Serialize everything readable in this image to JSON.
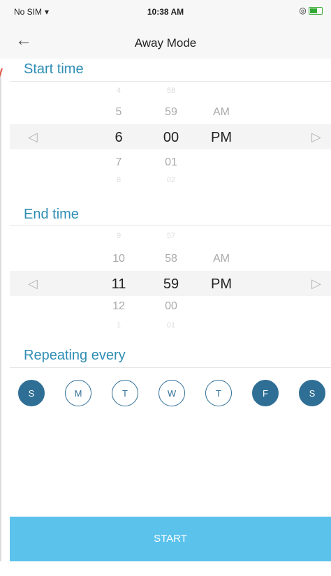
{
  "status": {
    "carrier": "No SIM",
    "time": "10:38 AM"
  },
  "nav": {
    "back_icon": "arrow-left-icon",
    "title": "Away Mode"
  },
  "start": {
    "title": "Start time",
    "hours": [
      "4",
      "5",
      "6",
      "7",
      "8"
    ],
    "minutes": [
      "58",
      "59",
      "00",
      "01",
      "02"
    ],
    "ampm": [
      "AM",
      "PM"
    ]
  },
  "end": {
    "title": "End time",
    "hours": [
      "9",
      "10",
      "11",
      "12",
      "1"
    ],
    "minutes": [
      "57",
      "58",
      "59",
      "00",
      "01"
    ],
    "ampm": [
      "AM",
      "PM"
    ]
  },
  "repeat": {
    "title": "Repeating every",
    "days": [
      {
        "label": "S",
        "selected": true
      },
      {
        "label": "M",
        "selected": false
      },
      {
        "label": "T",
        "selected": false
      },
      {
        "label": "W",
        "selected": false
      },
      {
        "label": "T",
        "selected": false
      },
      {
        "label": "F",
        "selected": true
      },
      {
        "label": "S",
        "selected": true
      }
    ]
  },
  "actions": {
    "start_label": "START"
  },
  "colors": {
    "accent": "#2f8db4",
    "button": "#5bc2ec",
    "day_selected": "#2f6f96"
  }
}
